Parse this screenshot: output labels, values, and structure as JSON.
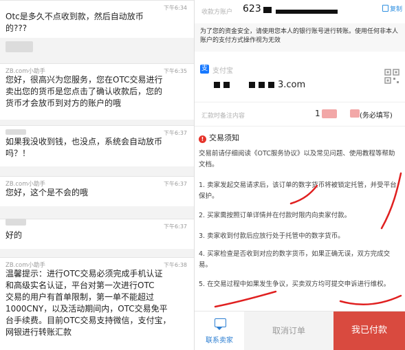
{
  "chat": {
    "messages": [
      {
        "sender": "",
        "time": "下午6:34",
        "lines": [
          "Otc是多久不点收到款，然后自动放币",
          "的???"
        ]
      },
      {
        "sender": "ZB.com小助手",
        "time": "下午6:35",
        "lines": [
          "您好，很高兴为您服务，您在OTC交易进行",
          "卖出您的货币是您点击了确认收款后，您的",
          "货币才会放币到对方的账户的哦"
        ]
      },
      {
        "sender": "",
        "time": "下午6:37",
        "lines": [
          "如果我没收到钱，也没点，系统会自动放币",
          "吗？！"
        ]
      },
      {
        "sender": "ZB.com小助手",
        "time": "下午6:37",
        "lines": [
          "您好，这个是不会的哦"
        ]
      },
      {
        "sender": "",
        "time": "下午6:37",
        "lines": [
          "好的"
        ]
      },
      {
        "sender": "ZB.com小助手",
        "time": "下午6:38",
        "lines": [
          "温馨提示：进行OTC交易必须完成手机认证",
          "和高级实名认证，平台对第一次进行OTC",
          "交易的用户有首单限制，第一单不能超过",
          "1000CNY，以及活动期间内，OTC交易免平",
          "台手续费。目前OTC交易支持微信，支付宝，",
          "网银进行转账汇款"
        ]
      }
    ]
  },
  "payment": {
    "account_label": "收款方账户",
    "account_prefix": "623",
    "copy_label": "复制",
    "notice": "为了您的资金安全，请使用您本人的银行账号进行转账。使用任何非本人账户的支付方式操作视为无效",
    "alipay_name": "支付宝",
    "alipay_logo": "支",
    "alipay_account_suffix": "3.com",
    "memo_label": "汇款时备注内容",
    "memo_prefix": "1",
    "memo_suffix": "(务必填写)",
    "rules_title": "交易须知",
    "warn_glyph": "!",
    "rules_intro": "交易前请仔细阅读《OTC服务协议》以及常见问题、使用教程等帮助文档。",
    "rules": [
      "1. 卖家发起交易请求后，该订单的数字货币将被锁定托管，并受平台保护。",
      "2. 买家需按照订单详情并在付款时限内向卖家付款。",
      "3. 卖家收到付款后应放行处于托管中的数字货币。",
      "4. 买家检查是否收到对应的数字货币，如果正确无误，双方完成交易。",
      "5. 在交易过程中如果发生争议，买卖双方均可提交申诉进行维权。"
    ],
    "buttons": {
      "contact": "联系卖家",
      "cancel": "取消订单",
      "paid": "我已付款"
    }
  }
}
